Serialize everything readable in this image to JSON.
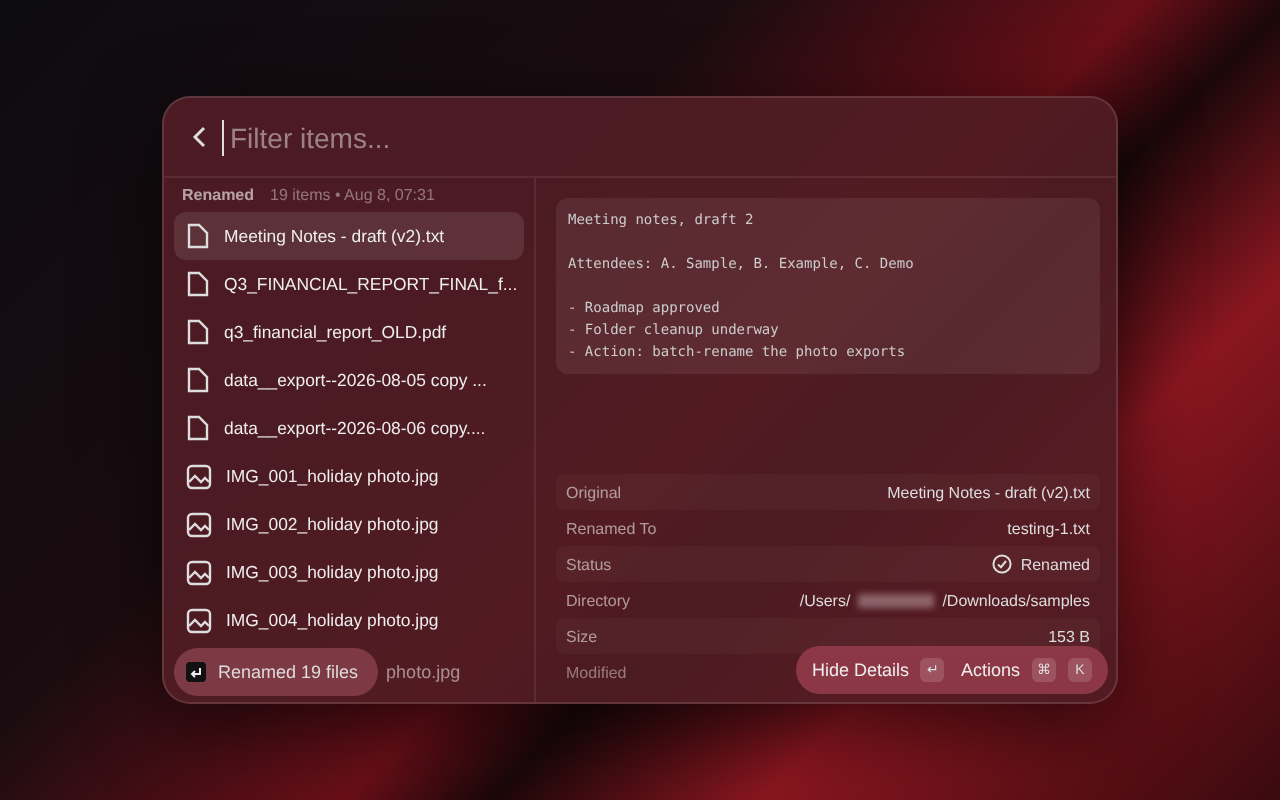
{
  "search": {
    "placeholder": "Filter items..."
  },
  "section": {
    "title": "Renamed",
    "meta": "19 items • Aug 8, 07:31"
  },
  "files": [
    {
      "name": "Meeting Notes - draft (v2).txt",
      "kind": "doc",
      "selected": true
    },
    {
      "name": "Q3_FINANCIAL_REPORT_FINAL_f...",
      "kind": "doc",
      "selected": false
    },
    {
      "name": "q3_financial_report_OLD.pdf",
      "kind": "doc",
      "selected": false
    },
    {
      "name": "data__export--2026-08-05 copy ...",
      "kind": "doc",
      "selected": false
    },
    {
      "name": "data__export--2026-08-06 copy....",
      "kind": "doc",
      "selected": false
    },
    {
      "name": "IMG_001_holiday photo.jpg",
      "kind": "image",
      "selected": false
    },
    {
      "name": "IMG_002_holiday photo.jpg",
      "kind": "image",
      "selected": false
    },
    {
      "name": "IMG_003_holiday photo.jpg",
      "kind": "image",
      "selected": false
    },
    {
      "name": "IMG_004_holiday photo.jpg",
      "kind": "image",
      "selected": false
    }
  ],
  "toast": {
    "label": "Renamed 19 files",
    "peek": "photo.jpg"
  },
  "preview": [
    [
      "Meeting notes, draft 2"
    ],
    [
      "Attendees: A. Sample, B. Example, C. Demo"
    ],
    [
      "- Roadmap approved",
      "- Folder cleanup underway",
      "- Action: batch-rename the photo exports"
    ]
  ],
  "details": [
    {
      "label": "Original",
      "value": "Meeting Notes - draft (v2).txt",
      "kind": "text"
    },
    {
      "label": "Renamed To",
      "value": "testing-1.txt",
      "kind": "text"
    },
    {
      "label": "Status",
      "value": "Renamed",
      "kind": "status"
    },
    {
      "label": "Directory",
      "value": "/Users/",
      "value_end": "/Downloads/samples",
      "kind": "redacted"
    },
    {
      "label": "Size",
      "value": "153 B",
      "kind": "text"
    },
    {
      "label": "Modified",
      "kind": "faded"
    }
  ],
  "actions": [
    {
      "label": "Hide Details",
      "keys": [
        "↵"
      ]
    },
    {
      "label": "Actions",
      "keys": [
        "⌘",
        "K"
      ]
    }
  ]
}
